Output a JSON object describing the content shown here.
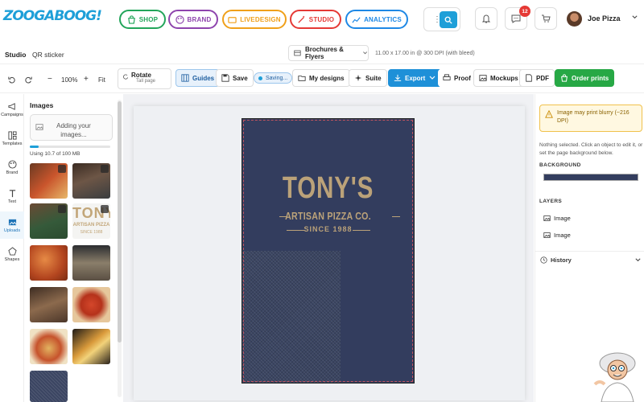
{
  "app": {
    "logo_text": "ZOOGABOOG!"
  },
  "nav": {
    "pills": [
      {
        "label": "SHOP",
        "color": "#22a55a",
        "icon": "shopping-bag-icon"
      },
      {
        "label": "BRAND",
        "color": "#8e44ad",
        "icon": "palette-icon"
      },
      {
        "label": "LIVEDESIGN",
        "color": "#f0a01a",
        "icon": "video-icon"
      },
      {
        "label": "STUDIO",
        "color": "#e53935",
        "icon": "magic-wand-icon"
      },
      {
        "label": "ANALYTICS",
        "color": "#1e88e5",
        "icon": "chart-icon"
      }
    ],
    "messages_badge": "12",
    "user_name": "Joe Pizza"
  },
  "subbar": {
    "studio_label": "Studio",
    "qr_label": "QR sticker",
    "doc_type": "Brochures & Flyers",
    "doc_size": "11.00 x 17.00 in @ 300 DPI (with bleed)"
  },
  "toolbar": {
    "zoom": "100%",
    "fit": "Fit",
    "rotate_title": "Rotate",
    "rotate_sub": "Tall page",
    "guides": "Guides",
    "save": "Save",
    "saving": "Saving...",
    "my_designs": "My designs",
    "suite": "Suite",
    "export": "Export",
    "proof": "Proof",
    "mockups": "Mockups",
    "pdf": "PDF",
    "order_prints": "Order prints"
  },
  "rail": [
    {
      "label": "Campaigns",
      "icon": "megaphone-icon"
    },
    {
      "label": "Templates",
      "icon": "templates-icon"
    },
    {
      "label": "Brand",
      "icon": "palette-icon"
    },
    {
      "label": "Text",
      "icon": "text-icon"
    },
    {
      "label": "Uploads",
      "icon": "image-icon"
    },
    {
      "label": "Shapes",
      "icon": "pentagon-icon"
    }
  ],
  "images_panel": {
    "title": "Images",
    "upload_text": "Adding your images...",
    "usage_text": "Using 10.7 of 100 MB",
    "usage_fraction": 0.107
  },
  "design": {
    "headline": "TONY'S",
    "subline": "ARTISAN PIZZA CO.",
    "since": "SINCE 1988",
    "thumb_headline": "TONY",
    "thumb_sub": "ARTISAN PIZZA",
    "thumb_since": "SINCE 1988",
    "background_color": "#333d5e",
    "gold": "#bba279"
  },
  "right_panel": {
    "warning": "Image may print blurry (~216 DPI)",
    "hint": "Nothing selected. Click an object to edit it, or set the page background below.",
    "background_label": "BACKGROUND",
    "layers_label": "LAYERS",
    "layers": [
      "Image",
      "Image"
    ],
    "history_label": "History"
  }
}
